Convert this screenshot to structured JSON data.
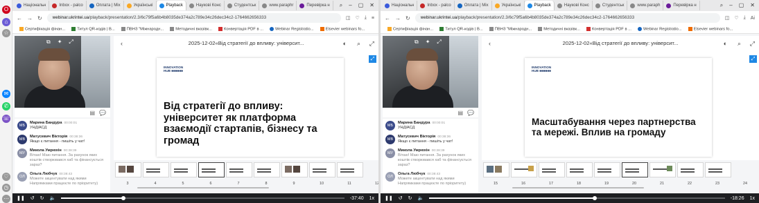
{
  "browser": {
    "tabs_left": [
      "Національн",
      "Inbox - palco",
      "Оплата | Mix",
      "Українські",
      "Playback",
      "Наукові Конс",
      "Студентськ",
      "www.paraphr",
      "Перевірка н"
    ],
    "tabs_right": [
      "Національн",
      "Inbox - palco",
      "Оплата | Mix",
      "Українські",
      "Playback",
      "Наукові Конс",
      "Студентськ",
      "www.paraph",
      "Перевірка н"
    ],
    "active_tab": "Playback",
    "url_host": "webinar.ukrintei.ua",
    "url_path": "/playback/presentation/2.3/6c79f5a6b4b8035de374a2c789e34c26dec34c2-1764662656333",
    "bookmarks": [
      "Сертифікація фінан...",
      "Титул QR-кодів | В...",
      "ПВНЗ \"Міжнародн...",
      "Методичні вказівк...",
      "Конвертація PDF в ...",
      "Webinar Registratio...",
      "Elsevier webinars fo..."
    ],
    "colors": {
      "accent": "#1e88e5",
      "player_bar": "#1e1f22",
      "chrome_bg": "#e9e9ea"
    }
  },
  "presentation": {
    "title": "2025-12-02«Від стратегії до впливу: університ...",
    "logo_line1": "INNOVATION",
    "logo_line2": "HUB ■■■■■■"
  },
  "chat": [
    {
      "initials": "МБ",
      "name": "Марина Бандура",
      "time": "00:00:01",
      "text": "УНДІАСД",
      "color": "#3a4a8a"
    },
    {
      "initials": "МВ",
      "name": "Матусевич Вікторія",
      "time": "00:38:36",
      "text": "Якщо є питання - пишіть у чат!",
      "color": "#2d3a6e"
    },
    {
      "initials": "МУ",
      "name": "Микола Умрюхін",
      "time": "00:38:39",
      "text": "Вітаю! Маю питання. За рахунок яких коштів створювався хаб та фінансується зараз?",
      "color": "#8a8fa6"
    },
    {
      "initials": "ОЛ",
      "name": "Ольга Любчук",
      "time": "00:38:43",
      "text": "Можете акцентувати над якими Напрямками працюєте по пріоритету)",
      "color": "#9aa0b4"
    }
  ],
  "left": {
    "slide_title": "Від стратегії до впливу: університет як платформа взаємодії стартапів, бізнесу та громад",
    "slide_numbers": [
      "3",
      "4",
      "5",
      "6",
      "7",
      "8",
      "9",
      "10",
      "11",
      "12"
    ],
    "current_slide": "6",
    "time_remaining": "-37:40",
    "progress": 0.22,
    "speed": "1x"
  },
  "right": {
    "slide_title": "Масштабування через партнерства та мережі. Вплив на громаду",
    "slide_numbers": [
      "15",
      "16",
      "17",
      "18",
      "19",
      "20",
      "21",
      "22",
      "23",
      "24"
    ],
    "current_slide": "20",
    "time_remaining": "-18:26",
    "progress": 0.56,
    "speed": "1x"
  }
}
